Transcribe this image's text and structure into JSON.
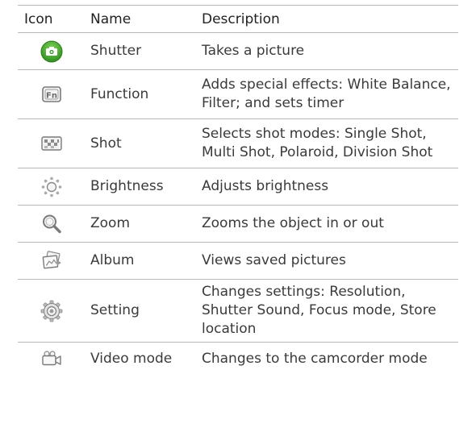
{
  "header": {
    "icon": "Icon",
    "name": "Name",
    "description": "Description"
  },
  "rows": [
    {
      "icon": "camera-shutter-icon",
      "name": "Shutter",
      "description": "Takes a picture"
    },
    {
      "icon": "function-fn-icon",
      "name": "Function",
      "description": "Adds special effects: White Balance, Filter; and sets timer"
    },
    {
      "icon": "shot-mode-icon",
      "name": "Shot",
      "description": "Selects shot modes: Single Shot, Multi Shot, Polaroid, Division Shot"
    },
    {
      "icon": "brightness-sun-icon",
      "name": "Brightness",
      "description": "Adjusts brightness"
    },
    {
      "icon": "zoom-magnifier-icon",
      "name": "Zoom",
      "description": "Zooms the object in or out"
    },
    {
      "icon": "album-pictures-icon",
      "name": "Album",
      "description": "Views saved pictures"
    },
    {
      "icon": "setting-gear-icon",
      "name": "Setting",
      "description": "Changes settings: Resolution, Shutter Sound, Focus mode, Store location"
    },
    {
      "icon": "video-camcorder-icon",
      "name": "Video mode",
      "description": "Changes to the camcorder mode"
    }
  ]
}
